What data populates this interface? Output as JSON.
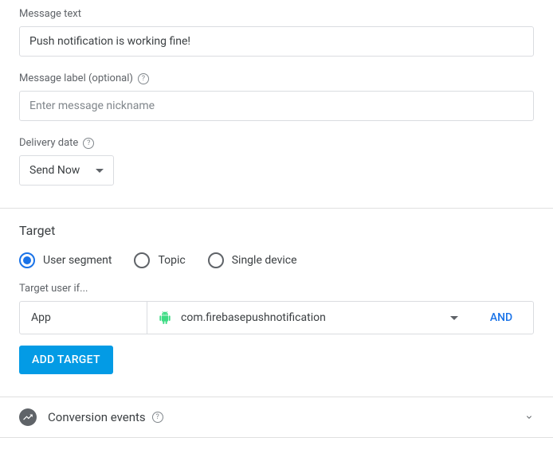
{
  "message_text": {
    "label": "Message text",
    "value": "Push notification is working fine!"
  },
  "message_label": {
    "label": "Message label (optional)",
    "placeholder": "Enter message nickname",
    "value": ""
  },
  "delivery_date": {
    "label": "Delivery date",
    "selected": "Send Now"
  },
  "target": {
    "title": "Target",
    "options": {
      "user_segment": "User segment",
      "topic": "Topic",
      "single_device": "Single device"
    },
    "selected": "user_segment",
    "filter_label": "Target user if...",
    "app_label": "App",
    "app_value": "com.firebasepushnotification",
    "and_label": "AND",
    "add_button": "ADD TARGET"
  },
  "conversion": {
    "title": "Conversion events"
  }
}
